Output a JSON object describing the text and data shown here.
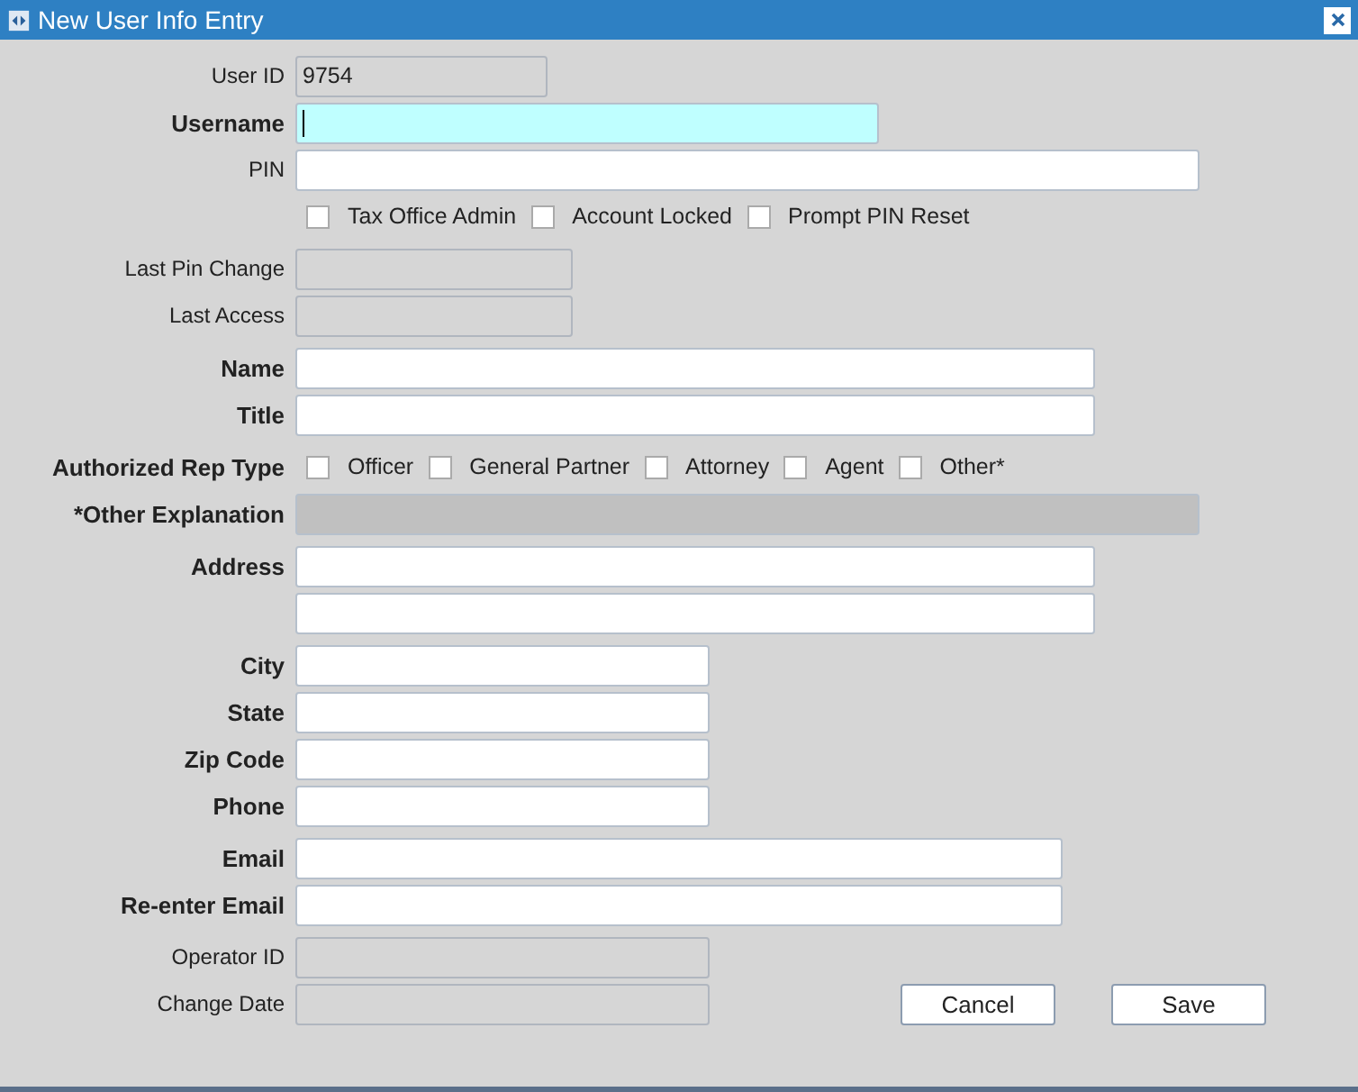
{
  "window": {
    "title": "New User Info Entry"
  },
  "sections": [
    {
      "rows": [
        {
          "kind": "field",
          "label": "User ID",
          "bold": false,
          "focused": false,
          "readonly": true,
          "disabled": false,
          "value": "9754"
        },
        {
          "kind": "field",
          "label": "Username",
          "bold": true,
          "focused": true,
          "readonly": false,
          "disabled": false
        },
        {
          "kind": "field",
          "label": "PIN",
          "bold": false,
          "focused": false,
          "readonly": false,
          "disabled": false
        },
        {
          "kind": "checks",
          "items": [
            {
              "label": "Tax Office Admin",
              "checked": false
            },
            {
              "label": "Account Locked",
              "checked": false
            },
            {
              "label": "Prompt PIN Reset",
              "checked": false
            }
          ]
        }
      ]
    },
    {
      "rows": [
        {
          "kind": "field",
          "label": "Last Pin Change",
          "bold": false,
          "focused": false,
          "readonly": true,
          "disabled": false
        },
        {
          "kind": "field",
          "label": "Last Access",
          "bold": false,
          "focused": false,
          "readonly": true,
          "disabled": false
        }
      ]
    },
    {
      "rows": [
        {
          "kind": "field",
          "label": "Name",
          "bold": true,
          "focused": false,
          "readonly": false,
          "disabled": false
        },
        {
          "kind": "field",
          "label": "Title",
          "bold": true,
          "focused": false,
          "readonly": false,
          "disabled": false
        }
      ]
    },
    {
      "rows": [
        {
          "kind": "checks",
          "label": "Authorized Rep Type",
          "bold": true,
          "items": [
            {
              "label": "Officer",
              "checked": false
            },
            {
              "label": "General Partner",
              "checked": false
            },
            {
              "label": "Attorney",
              "checked": false
            },
            {
              "label": "Agent",
              "checked": false
            },
            {
              "label": "Other*",
              "checked": false
            }
          ]
        },
        {
          "kind": "field",
          "label": "*Other Explanation",
          "bold": true,
          "focused": false,
          "readonly": false,
          "disabled": true
        }
      ]
    },
    {
      "rows": [
        {
          "kind": "field",
          "label": "Address",
          "bold": true,
          "focused": false,
          "readonly": false,
          "disabled": false
        },
        {
          "kind": "field",
          "focused": false,
          "readonly": false,
          "disabled": false
        }
      ]
    },
    {
      "rows": [
        {
          "kind": "field",
          "label": "City",
          "bold": true,
          "focused": false,
          "readonly": false,
          "disabled": false
        },
        {
          "kind": "field",
          "label": "State",
          "bold": true,
          "focused": false,
          "readonly": false,
          "disabled": false
        },
        {
          "kind": "field",
          "label": "Zip Code",
          "bold": true,
          "focused": false,
          "readonly": false,
          "disabled": false
        },
        {
          "kind": "field",
          "label": "Phone",
          "bold": true,
          "focused": false,
          "readonly": false,
          "disabled": false
        }
      ]
    },
    {
      "rows": [
        {
          "kind": "field",
          "label": "Email",
          "bold": true,
          "focused": false,
          "readonly": false,
          "disabled": false
        },
        {
          "kind": "field",
          "label": "Re-enter Email",
          "bold": true,
          "focused": false,
          "readonly": false,
          "disabled": false
        }
      ]
    },
    {
      "rows": [
        {
          "kind": "field",
          "label": "Operator ID",
          "bold": false,
          "focused": false,
          "readonly": true,
          "disabled": false
        },
        {
          "kind": "field",
          "label": "Change Date",
          "bold": false,
          "focused": false,
          "readonly": true,
          "disabled": false
        }
      ]
    }
  ],
  "buttons": [
    "Cancel",
    "Save"
  ]
}
